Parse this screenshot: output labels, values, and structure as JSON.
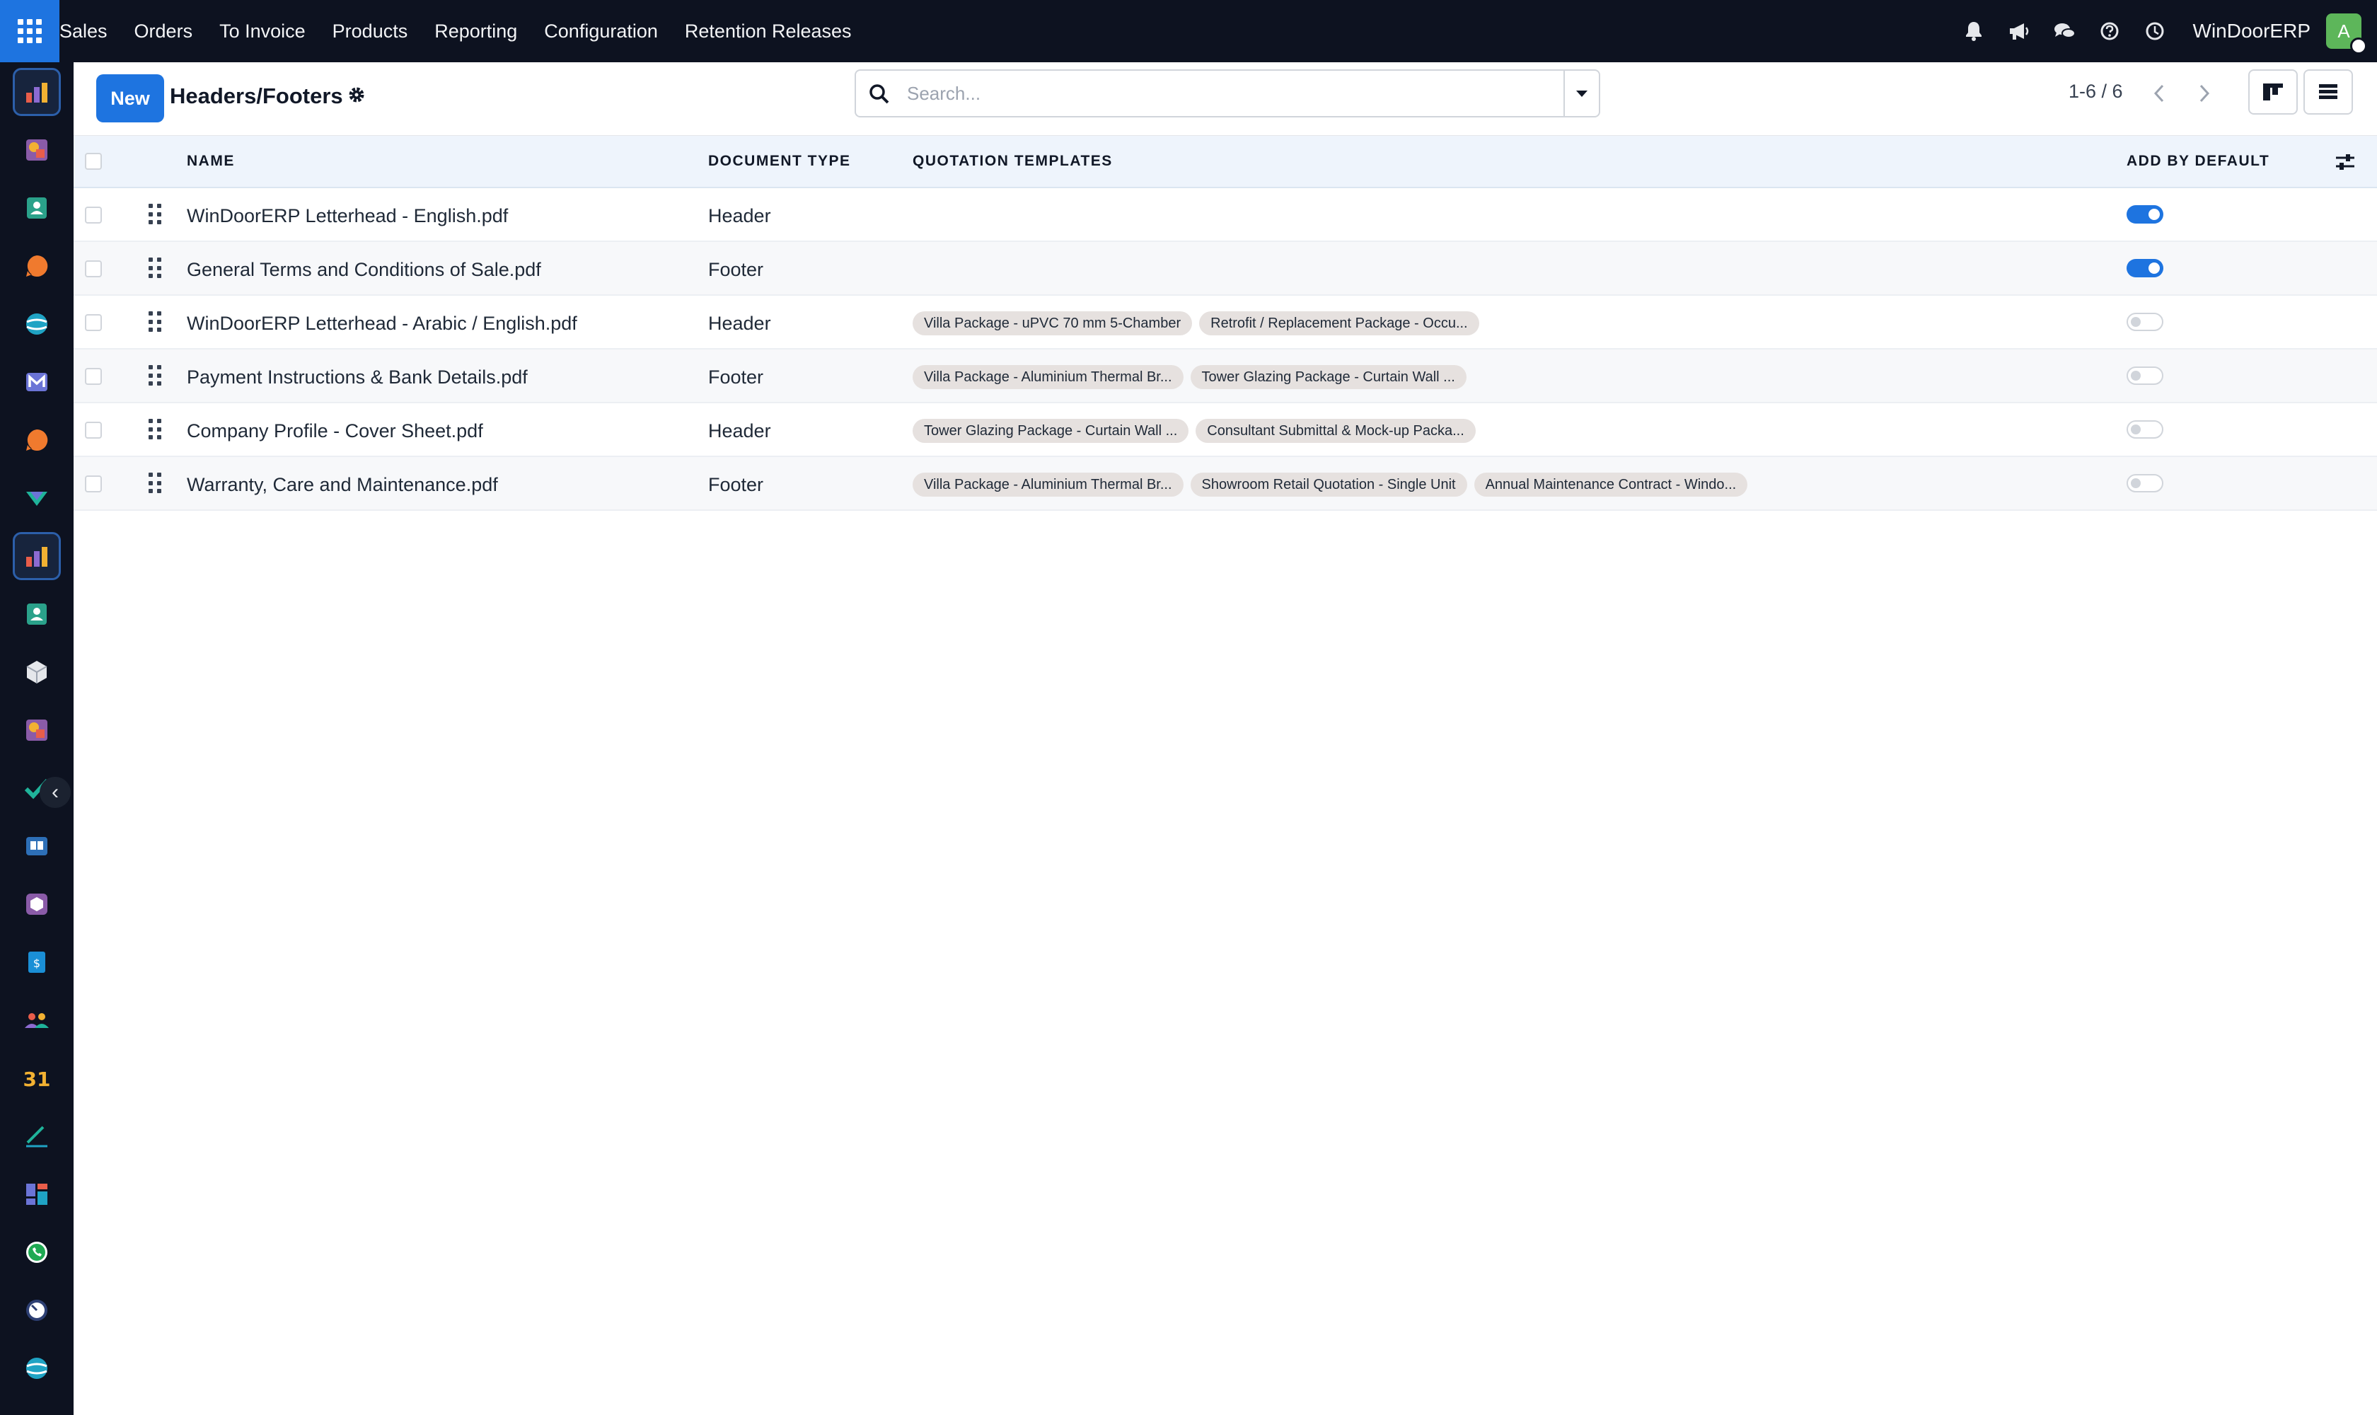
{
  "navbar": {
    "menu": [
      "Sales",
      "Orders",
      "To Invoice",
      "Products",
      "Reporting",
      "Configuration",
      "Retention Releases"
    ],
    "company": "WinDoorERP",
    "avatar_initial": "A"
  },
  "control": {
    "new_label": "New",
    "title": "Headers/Footers",
    "search_placeholder": "Search...",
    "pager": "1-6 / 6"
  },
  "table": {
    "columns": {
      "name": "NAME",
      "document_type": "DOCUMENT TYPE",
      "quotation_templates": "QUOTATION TEMPLATES",
      "add_by_default": "ADD BY DEFAULT"
    },
    "rows": [
      {
        "name": "WinDoorERP Letterhead - English.pdf",
        "type": "Header",
        "templates": [],
        "add_by_default": true
      },
      {
        "name": "General Terms and Conditions of Sale.pdf",
        "type": "Footer",
        "templates": [],
        "add_by_default": true
      },
      {
        "name": "WinDoorERP Letterhead - Arabic / English.pdf",
        "type": "Header",
        "templates": [
          "Villa Package - uPVC 70 mm 5-Chamber",
          "Retrofit / Replacement Package - Occu..."
        ],
        "add_by_default": false
      },
      {
        "name": "Payment Instructions & Bank Details.pdf",
        "type": "Footer",
        "templates": [
          "Villa Package - Aluminium Thermal Br...",
          "Tower Glazing Package - Curtain Wall ..."
        ],
        "add_by_default": false
      },
      {
        "name": "Company Profile - Cover Sheet.pdf",
        "type": "Header",
        "templates": [
          "Tower Glazing Package - Curtain Wall ...",
          "Consultant Submittal & Mock-up Packa..."
        ],
        "add_by_default": false
      },
      {
        "name": "Warranty, Care and Maintenance.pdf",
        "type": "Footer",
        "templates": [
          "Villa Package - Aluminium Thermal Br...",
          "Showroom Retail Quotation - Single Unit",
          "Annual Maintenance Contract - Windo..."
        ],
        "add_by_default": false
      }
    ]
  },
  "colors": {
    "navbar_bg": "#0d1220",
    "accent": "#1e74e0",
    "header_row_bg": "#eef4fc",
    "tag_bg": "#e6e1df",
    "avatar_bg": "#5db65a"
  },
  "icons": {
    "topbar": [
      "bell-icon",
      "megaphone-icon",
      "chat-icon",
      "help-icon",
      "clock-icon"
    ],
    "sidebar": [
      "sales-app-icon",
      "pos-app-icon",
      "contacts-app-icon",
      "discuss-app-icon",
      "website-app-icon",
      "email-marketing-app-icon",
      "chat-app-icon",
      "inventory-app-icon",
      "sales-app-icon",
      "contacts-app-icon",
      "product-app-icon",
      "pos-app-icon",
      "project-app-icon",
      "knowledge-app-icon",
      "package-app-icon",
      "invoicing-app-icon",
      "employees-app-icon",
      "calendar-app-icon",
      "sign-app-icon",
      "dashboard-app-icon",
      "whatsapp-app-icon",
      "timesheet-app-icon",
      "website-app-icon"
    ]
  }
}
